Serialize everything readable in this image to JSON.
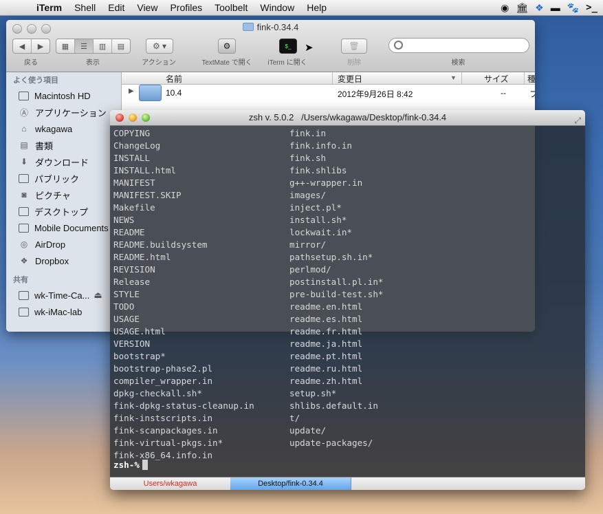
{
  "menubar": {
    "apple_icon": "apple-icon",
    "items": [
      "iTerm",
      "Shell",
      "Edit",
      "View",
      "Profiles",
      "Toolbelt",
      "Window",
      "Help"
    ],
    "status_icons": [
      "circle-status-icon",
      "museum-icon",
      "dropbox-icon",
      "display-icon",
      "paw-icon",
      "terminal-icon"
    ]
  },
  "finder": {
    "title": "fink-0.34.4",
    "toolbar": {
      "back_label": "戻る",
      "view_label": "表示",
      "action_label": "アクション",
      "textmate_label": "TextMate で開く",
      "iterm_label": "iTerm に開く",
      "delete_label": "削除",
      "search_label": "検索",
      "search_placeholder": ""
    },
    "sidebar": {
      "favorites_header": "よく使う項目",
      "favorites": [
        {
          "label": "Macintosh HD",
          "icon": "hard-drive-icon"
        },
        {
          "label": "アプリケーション",
          "icon": "applications-icon"
        },
        {
          "label": "wkagawa",
          "icon": "home-icon"
        },
        {
          "label": "書類",
          "icon": "documents-icon"
        },
        {
          "label": "ダウンロード",
          "icon": "downloads-icon"
        },
        {
          "label": "パブリック",
          "icon": "folder-icon"
        },
        {
          "label": "ピクチャ",
          "icon": "camera-icon"
        },
        {
          "label": "デスクトップ",
          "icon": "desktop-icon"
        },
        {
          "label": "Mobile Documents",
          "icon": "folder-icon"
        },
        {
          "label": "AirDrop",
          "icon": "airdrop-icon"
        },
        {
          "label": "Dropbox",
          "icon": "dropbox-icon"
        }
      ],
      "shared_header": "共有",
      "shared": [
        {
          "label": "wk-Time-Ca...",
          "icon": "server-icon",
          "eject": "⏏"
        },
        {
          "label": "wk-iMac-lab",
          "icon": "imac-icon"
        }
      ]
    },
    "columns": {
      "name": "名前",
      "modified": "変更日",
      "size": "サイズ",
      "kind": "種"
    },
    "rows": [
      {
        "name": "10.4",
        "modified": "2012年9月26日 8:42",
        "size": "--",
        "kind": "フ"
      }
    ]
  },
  "iterm": {
    "title": "zsh v. 5.0.2   /Users/wkagawa/Desktop/fink-0.34.4",
    "left_column": [
      "COPYING",
      "ChangeLog",
      "INSTALL",
      "INSTALL.html",
      "MANIFEST",
      "MANIFEST.SKIP",
      "Makefile",
      "NEWS",
      "README",
      "README.buildsystem",
      "README.html",
      "REVISION",
      "Release",
      "STYLE",
      "TODO",
      "USAGE",
      "USAGE.html",
      "VERSION",
      "bootstrap*",
      "bootstrap-phase2.pl",
      "compiler_wrapper.in",
      "dpkg-checkall.sh*",
      "fink-dpkg-status-cleanup.in",
      "fink-instscripts.in",
      "fink-scanpackages.in",
      "fink-virtual-pkgs.in*",
      "fink-x86_64.info.in"
    ],
    "right_column": [
      "fink.in",
      "fink.info.in",
      "fink.sh",
      "fink.shlibs",
      "g++-wrapper.in",
      "images/",
      "inject.pl*",
      "install.sh*",
      "lockwait.in*",
      "mirror/",
      "pathsetup.sh.in*",
      "perlmod/",
      "postinstall.pl.in*",
      "pre-build-test.sh*",
      "readme.en.html",
      "readme.es.html",
      "readme.fr.html",
      "readme.ja.html",
      "readme.pt.html",
      "readme.ru.html",
      "readme.zh.html",
      "setup.sh*",
      "shlibs.default.in",
      "t/",
      "update/",
      "update-packages/"
    ],
    "prompt": "zsh-%",
    "tabs": [
      {
        "label": "Users/wkagawa",
        "color": "#d52a21"
      },
      {
        "label": "Desktop/fink-0.34.4",
        "color": "#111111"
      }
    ]
  }
}
